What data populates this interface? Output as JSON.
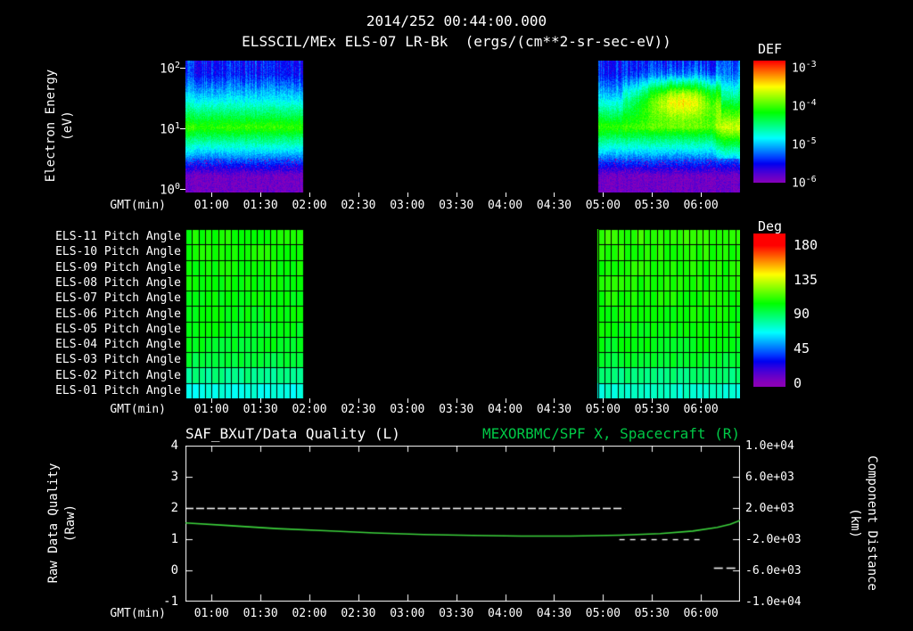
{
  "colors": {
    "background": "#000000",
    "text": "#ffffff",
    "title_right_green": "#00c846",
    "orbit_curve_green": "#3cd23c",
    "quality_line_white": "#ffffff"
  },
  "header": {
    "timestamp": "2014/252 00:44:00.000",
    "title": "ELSSCIL/MEx ELS-07 LR-Bk  (ergs/(cm**2-sr-sec-eV))"
  },
  "time_axis": {
    "label": "GMT(min)",
    "start_min": 44,
    "end_min": 384,
    "tick_labels": [
      "01:00",
      "01:30",
      "02:00",
      "02:30",
      "03:00",
      "03:30",
      "04:00",
      "04:30",
      "05:00",
      "05:30",
      "06:00"
    ],
    "tick_minutes": [
      60,
      90,
      120,
      150,
      180,
      210,
      240,
      270,
      300,
      330,
      360
    ]
  },
  "spectrogram_panel": {
    "ylabel_line1": "Electron Energy",
    "ylabel_line2": "(eV)",
    "yticks": [
      {
        "base": "10",
        "exp": "2"
      },
      {
        "base": "10",
        "exp": "1"
      },
      {
        "base": "10",
        "exp": "0"
      }
    ],
    "colorbar": {
      "title": "DEF",
      "ticks": [
        {
          "base": "10",
          "exp": "-3"
        },
        {
          "base": "10",
          "exp": "-4"
        },
        {
          "base": "10",
          "exp": "-5"
        },
        {
          "base": "10",
          "exp": "-6"
        }
      ]
    }
  },
  "pitch_panel": {
    "row_labels": [
      "ELS-11 Pitch Angle",
      "ELS-10 Pitch Angle",
      "ELS-09 Pitch Angle",
      "ELS-08 Pitch Angle",
      "ELS-07 Pitch Angle",
      "ELS-06 Pitch Angle",
      "ELS-05 Pitch Angle",
      "ELS-04 Pitch Angle",
      "ELS-03 Pitch Angle",
      "ELS-02 Pitch Angle",
      "ELS-01 Pitch Angle"
    ],
    "colorbar": {
      "title": "Deg",
      "ticks": [
        180,
        135,
        90,
        45,
        0
      ],
      "render_top_deg": 195,
      "render_bottom_deg": -5
    }
  },
  "line_panel": {
    "title_left": "SAF_BXuT/Data Quality (L)",
    "title_right": "MEXORBMC/SPF X, Spacecraft (R)",
    "left_axis": {
      "label_line1": "Raw Data Quality",
      "label_line2": "(Raw)",
      "ticks": [
        4,
        3,
        2,
        1,
        0,
        -1
      ]
    },
    "right_axis": {
      "label_line1": "Component Distance",
      "label_line2": "(km)",
      "ticks": [
        "1.0e+04",
        "6.0e+03",
        "2.0e+03",
        "-2.0e+03",
        "-6.0e+03",
        "-1.0e+04"
      ]
    }
  },
  "chart_data": [
    {
      "type": "heatmap",
      "title": "ELSSCIL/MEx ELS-07 LR-Bk electron energy-time spectrogram",
      "xlabel": "GMT(min)",
      "ylabel": "Electron Energy (eV)",
      "x_range_minutes": [
        44,
        384
      ],
      "y_log10_range_render": [
        -0.06,
        2.12
      ],
      "y_ticks_eV": [
        1,
        10,
        100
      ],
      "colorbar": {
        "title": "DEF",
        "units": "ergs/(cm**2-sr-sec-eV)",
        "tick_exponents": [
          -3,
          -4,
          -5,
          -6
        ],
        "log_min": -6.03,
        "log_max": -2.84
      },
      "data_blocks": [
        {
          "t0_min": 44,
          "t1_min": 116
        },
        {
          "t0_min": 297,
          "t1_min": 384
        }
      ],
      "energy_bands": [
        {
          "eV": [
            1,
            2.8
          ],
          "log10_flux": -5.9
        },
        {
          "eV": [
            2.8,
            5.6
          ],
          "log10_flux": -5.0
        },
        {
          "eV": [
            5.6,
            20
          ],
          "log10_flux": -4.05
        },
        {
          "eV": [
            20,
            50
          ],
          "log10_flux": -4.9
        },
        {
          "eV": [
            50,
            130
          ],
          "log10_flux": -5.45
        }
      ],
      "enhancement": {
        "t_min": [
          312,
          372
        ],
        "t_peak": 348,
        "t_sigma": 26,
        "logE_center": 1.5,
        "logE_sigma": 0.33,
        "peak_boost": 1.35
      },
      "end_brightening": {
        "t_start_min": 366,
        "boost": 0.45
      }
    },
    {
      "type": "heatmap",
      "title": "ELS pitch angle panels",
      "rows_top_to_bottom": [
        "ELS-11",
        "ELS-10",
        "ELS-09",
        "ELS-08",
        "ELS-07",
        "ELS-06",
        "ELS-05",
        "ELS-04",
        "ELS-03",
        "ELS-02",
        "ELS-01"
      ],
      "units": "Deg",
      "value_range": [
        0,
        180
      ],
      "data_blocks": [
        {
          "t0_min": 44,
          "t1_min": 116
        },
        {
          "t0_min": 297,
          "t1_min": 384
        }
      ],
      "block_values_deg": [
        [
          107,
          106,
          105,
          104,
          103,
          102,
          101,
          99,
          95,
          84,
          70
        ],
        [
          111,
          109,
          108,
          107,
          106,
          105,
          103,
          101,
          97,
          86,
          73
        ]
      ],
      "grid_minutes": 4
    },
    {
      "type": "line",
      "xlabel": "GMT(min)",
      "x_range_minutes": [
        44,
        384
      ],
      "left_ylim": [
        -1,
        4
      ],
      "right_ylim": [
        -10000,
        10000
      ],
      "series": [
        {
          "name": "SAF_BXuT/Data Quality (L)",
          "axis": "left",
          "color": "#ffffff",
          "style": "dashed",
          "segments": [
            {
              "t_min": [
                44,
                313
              ],
              "value": 2.0,
              "dash": [
                9,
                3
              ]
            },
            {
              "t_min": [
                310,
                360
              ],
              "value": 1.0,
              "dash": [
                6,
                6
              ]
            },
            {
              "t_min": [
                368,
                383
              ],
              "value": 0.1,
              "dash": [
                10,
                4
              ]
            }
          ]
        },
        {
          "name": "MEXORBMC/SPF X, Spacecraft (R)",
          "axis": "right",
          "color": "#3cd23c",
          "x_min": [
            44,
            70,
            100,
            130,
            160,
            190,
            220,
            250,
            280,
            310,
            335,
            355,
            370,
            378,
            384
          ],
          "y_km": [
            80,
            -240,
            -640,
            -920,
            -1200,
            -1400,
            -1520,
            -1600,
            -1600,
            -1480,
            -1280,
            -960,
            -480,
            -80,
            400
          ]
        }
      ]
    }
  ]
}
